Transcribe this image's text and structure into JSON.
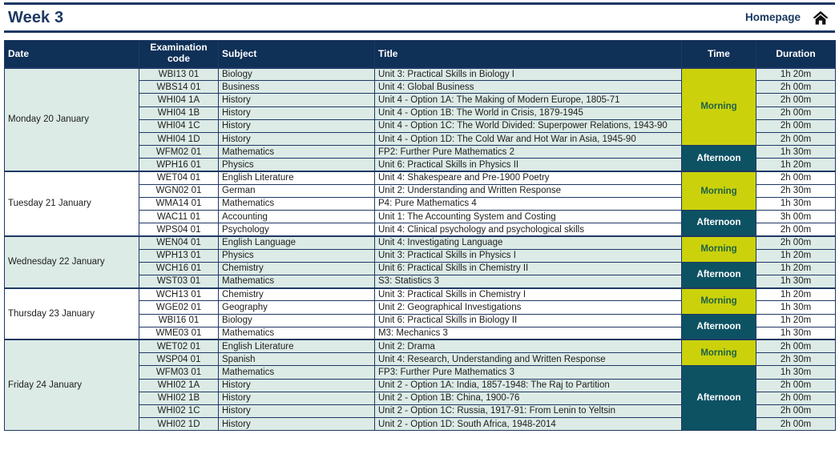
{
  "header": {
    "week_title": "Week 3",
    "homepage_label": "Homepage",
    "home_icon": "home-icon"
  },
  "colors": {
    "header_navy": "#0f3057",
    "title_navy": "#1f3864",
    "morning_bg": "#cbd20b",
    "morning_text": "#1f6145",
    "afternoon_bg": "#0d5263",
    "afternoon_text": "#ffffff",
    "row_teal": "#dcebe6",
    "row_white": "#ffffff"
  },
  "table": {
    "columns": [
      {
        "key": "date",
        "label": "Date"
      },
      {
        "key": "code",
        "label": "Examination code"
      },
      {
        "key": "subject",
        "label": "Subject"
      },
      {
        "key": "title",
        "label": "Title"
      },
      {
        "key": "time",
        "label": "Time"
      },
      {
        "key": "duration",
        "label": "Duration"
      }
    ],
    "days": [
      {
        "date": "Monday 20 January",
        "band": "teal",
        "sessions": [
          {
            "time": "Morning",
            "exams": [
              {
                "code": "WBI13 01",
                "subject": "Biology",
                "title": "Unit 3: Practical Skills in Biology I",
                "duration": "1h 20m"
              },
              {
                "code": "WBS14 01",
                "subject": "Business",
                "title": "Unit 4: Global Business",
                "duration": "2h 00m"
              },
              {
                "code": "WHI04 1A",
                "subject": "History",
                "title": "Unit 4 - Option 1A: The Making of Modern Europe, 1805-71",
                "duration": "2h 00m"
              },
              {
                "code": "WHI04 1B",
                "subject": "History",
                "title": "Unit 4 - Option 1B: The World in Crisis, 1879-1945",
                "duration": "2h 00m"
              },
              {
                "code": "WHI04 1C",
                "subject": "History",
                "title": "Unit 4 - Option 1C: The World Divided: Superpower Relations, 1943-90",
                "duration": "2h 00m"
              },
              {
                "code": "WHI04 1D",
                "subject": "History",
                "title": "Unit 4 - Option 1D: The Cold War and Hot War in Asia, 1945-90",
                "duration": "2h 00m"
              }
            ]
          },
          {
            "time": "Afternoon",
            "exams": [
              {
                "code": "WFM02 01",
                "subject": "Mathematics",
                "title": "FP2: Further Pure Mathematics 2",
                "duration": "1h 30m"
              },
              {
                "code": "WPH16 01",
                "subject": "Physics",
                "title": "Unit 6: Practical Skills in Physics II",
                "duration": "1h 20m"
              }
            ]
          }
        ]
      },
      {
        "date": "Tuesday 21 January",
        "band": "white",
        "sessions": [
          {
            "time": "Morning",
            "exams": [
              {
                "code": "WET04 01",
                "subject": "English Literature",
                "title": "Unit 4: Shakespeare and Pre-1900 Poetry",
                "duration": "2h 00m"
              },
              {
                "code": "WGN02 01",
                "subject": "German",
                "title": "Unit 2: Understanding and Written Response",
                "duration": "2h 30m"
              },
              {
                "code": "WMA14 01",
                "subject": "Mathematics",
                "title": "P4: Pure Mathematics 4",
                "duration": "1h 30m"
              }
            ]
          },
          {
            "time": "Afternoon",
            "exams": [
              {
                "code": "WAC11 01",
                "subject": "Accounting",
                "title": "Unit 1: The Accounting System and Costing",
                "duration": "3h 00m"
              },
              {
                "code": "WPS04 01",
                "subject": "Psychology",
                "title": "Unit 4: Clinical psychology and psychological skills",
                "duration": "2h 00m"
              }
            ]
          }
        ]
      },
      {
        "date": "Wednesday 22 January",
        "band": "teal",
        "sessions": [
          {
            "time": "Morning",
            "exams": [
              {
                "code": "WEN04 01",
                "subject": "English Language",
                "title": "Unit 4: Investigating Language",
                "duration": "2h 00m"
              },
              {
                "code": "WPH13 01",
                "subject": "Physics",
                "title": "Unit 3: Practical Skills in Physics I",
                "duration": "1h 20m"
              }
            ]
          },
          {
            "time": "Afternoon",
            "exams": [
              {
                "code": "WCH16 01",
                "subject": "Chemistry",
                "title": "Unit 6: Practical Skills in Chemistry II",
                "duration": "1h 20m"
              },
              {
                "code": "WST03 01",
                "subject": "Mathematics",
                "title": "S3: Statistics 3",
                "duration": "1h 30m"
              }
            ]
          }
        ]
      },
      {
        "date": "Thursday 23 January",
        "band": "white",
        "sessions": [
          {
            "time": "Morning",
            "exams": [
              {
                "code": "WCH13 01",
                "subject": "Chemistry",
                "title": "Unit 3: Practical Skills in Chemistry I",
                "duration": "1h 20m"
              },
              {
                "code": "WGE02 01",
                "subject": "Geography",
                "title": "Unit 2: Geographical Investigations",
                "duration": "1h 30m"
              }
            ]
          },
          {
            "time": "Afternoon",
            "exams": [
              {
                "code": "WBI16 01",
                "subject": "Biology",
                "title": "Unit 6: Practical Skills in Biology II",
                "duration": "1h 20m"
              },
              {
                "code": "WME03 01",
                "subject": "Mathematics",
                "title": "M3: Mechanics 3",
                "duration": "1h 30m"
              }
            ]
          }
        ]
      },
      {
        "date": "Friday 24 January",
        "band": "teal",
        "sessions": [
          {
            "time": "Morning",
            "exams": [
              {
                "code": "WET02 01",
                "subject": "English Literature",
                "title": "Unit 2: Drama",
                "duration": "2h 00m"
              },
              {
                "code": "WSP04 01",
                "subject": "Spanish",
                "title": "Unit 4: Research, Understanding and Written Response",
                "duration": "2h 30m"
              }
            ]
          },
          {
            "time": "Afternoon",
            "exams": [
              {
                "code": "WFM03 01",
                "subject": "Mathematics",
                "title": "FP3: Further Pure Mathematics 3",
                "duration": "1h 30m"
              },
              {
                "code": "WHI02 1A",
                "subject": "History",
                "title": "Unit 2 - Option 1A: India, 1857-1948: The Raj to Partition",
                "duration": "2h 00m"
              },
              {
                "code": "WHI02 1B",
                "subject": "History",
                "title": "Unit 2 - Option 1B: China, 1900-76",
                "duration": "2h 00m"
              },
              {
                "code": "WHI02 1C",
                "subject": "History",
                "title": "Unit 2 - Option 1C: Russia, 1917-91: From Lenin to Yeltsin",
                "duration": "2h 00m"
              },
              {
                "code": "WHI02 1D",
                "subject": "History",
                "title": "Unit 2 - Option 1D: South Africa, 1948-2014",
                "duration": "2h 00m"
              }
            ]
          }
        ]
      }
    ]
  }
}
